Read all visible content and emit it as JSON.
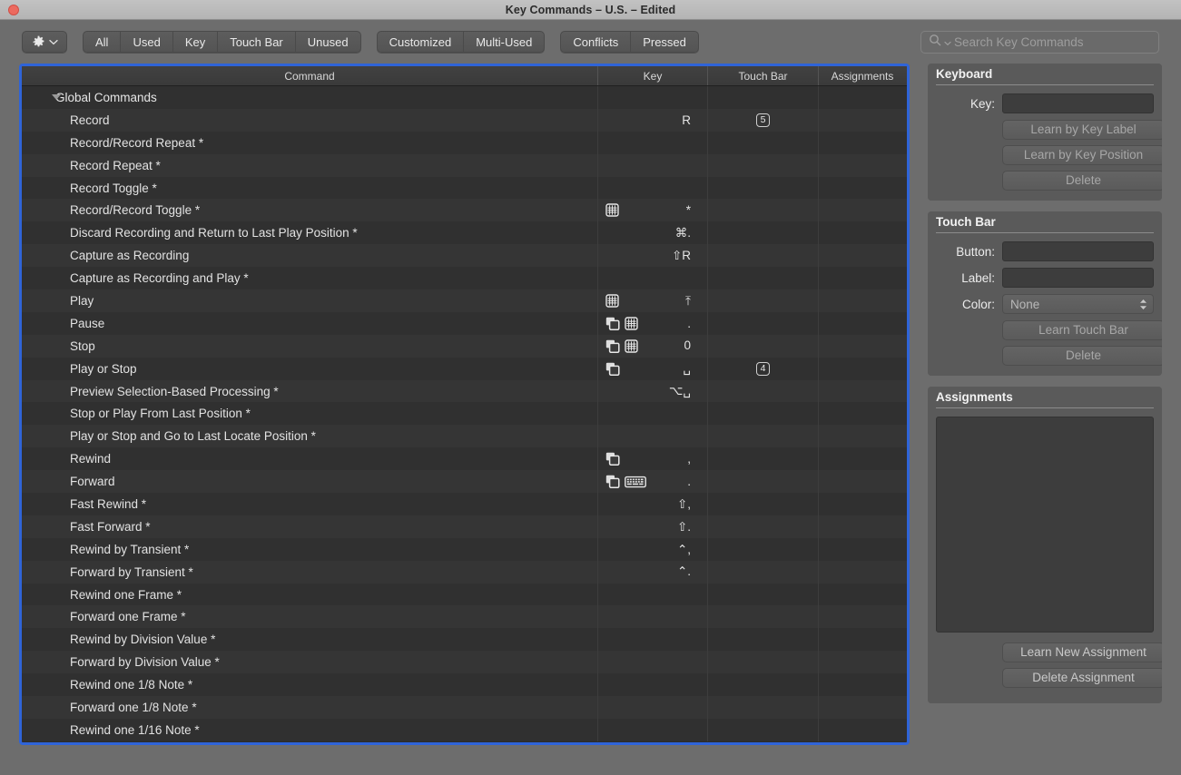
{
  "window": {
    "title": "Key Commands – U.S. – Edited",
    "accent_blue": "#2f64d8",
    "titlebar_bg": "#b9b9b9",
    "chrome_bg": "#6d6d6d",
    "table_bg": "#2c2c2c"
  },
  "toolbar": {
    "gear_icon": "gear-icon",
    "gear_chevron_icon": "chevron-down-icon",
    "filters_primary": [
      "All",
      "Used",
      "Key",
      "Touch Bar",
      "Unused"
    ],
    "filters_secondary": [
      "Customized",
      "Multi-Used"
    ],
    "filters_tertiary": [
      "Conflicts",
      "Pressed"
    ],
    "search": {
      "icon": "search-icon",
      "chevron_icon": "chevron-down-icon",
      "placeholder": "Search Key Commands",
      "value": ""
    }
  },
  "table": {
    "columns": [
      "Command",
      "Key",
      "Touch Bar",
      "Assignments"
    ],
    "rows": [
      {
        "type": "group",
        "command": "Global Commands",
        "key": "",
        "icons": [],
        "touchbar": "",
        "assignments": ""
      },
      {
        "type": "item",
        "command": "Record",
        "key": "R",
        "icons": [],
        "touchbar": "5",
        "assignments": ""
      },
      {
        "type": "item",
        "command": "Record/Record Repeat *",
        "key": "",
        "icons": [],
        "touchbar": "",
        "assignments": ""
      },
      {
        "type": "item",
        "command": "Record Repeat *",
        "key": "",
        "icons": [],
        "touchbar": "",
        "assignments": ""
      },
      {
        "type": "item",
        "command": "Record Toggle *",
        "key": "",
        "icons": [],
        "touchbar": "",
        "assignments": ""
      },
      {
        "type": "item",
        "command": "Record/Record Toggle *",
        "key": "*",
        "icons": [
          "numeric-keypad-icon"
        ],
        "touchbar": "",
        "assignments": ""
      },
      {
        "type": "item",
        "command": "Discard Recording and Return to Last Play Position *",
        "key": "⌘.",
        "icons": [],
        "touchbar": "",
        "assignments": ""
      },
      {
        "type": "item",
        "command": "Capture as Recording",
        "key": "⇧R",
        "icons": [],
        "touchbar": "",
        "assignments": ""
      },
      {
        "type": "item",
        "command": "Capture as Recording and Play *",
        "key": "",
        "icons": [],
        "touchbar": "",
        "assignments": ""
      },
      {
        "type": "item",
        "command": "Play",
        "key": "⤒",
        "icons": [
          "numeric-keypad-icon"
        ],
        "touchbar": "",
        "assignments": ""
      },
      {
        "type": "item",
        "command": "Pause",
        "key": ".",
        "icons": [
          "all-windows-icon",
          "numeric-keypad-icon"
        ],
        "touchbar": "",
        "assignments": ""
      },
      {
        "type": "item",
        "command": "Stop",
        "key": "0",
        "icons": [
          "all-windows-icon",
          "numeric-keypad-icon"
        ],
        "touchbar": "",
        "assignments": ""
      },
      {
        "type": "item",
        "command": "Play or Stop",
        "key": "␣",
        "icons": [
          "all-windows-icon"
        ],
        "touchbar": "4",
        "assignments": ""
      },
      {
        "type": "item",
        "command": "Preview Selection-Based Processing *",
        "key": "⌥␣",
        "icons": [],
        "touchbar": "",
        "assignments": ""
      },
      {
        "type": "item",
        "command": "Stop or Play From Last Position *",
        "key": "",
        "icons": [],
        "touchbar": "",
        "assignments": ""
      },
      {
        "type": "item",
        "command": "Play or Stop and Go to Last Locate Position *",
        "key": "",
        "icons": [],
        "touchbar": "",
        "assignments": ""
      },
      {
        "type": "item",
        "command": "Rewind",
        "key": ",",
        "icons": [
          "all-windows-icon"
        ],
        "touchbar": "",
        "assignments": ""
      },
      {
        "type": "item",
        "command": "Forward",
        "key": ".",
        "icons": [
          "all-windows-icon",
          "keyboard-icon"
        ],
        "touchbar": "",
        "assignments": ""
      },
      {
        "type": "item",
        "command": "Fast Rewind *",
        "key": "⇧,",
        "icons": [],
        "touchbar": "",
        "assignments": ""
      },
      {
        "type": "item",
        "command": "Fast Forward *",
        "key": "⇧.",
        "icons": [],
        "touchbar": "",
        "assignments": ""
      },
      {
        "type": "item",
        "command": "Rewind by Transient *",
        "key": "⌃,",
        "icons": [],
        "touchbar": "",
        "assignments": ""
      },
      {
        "type": "item",
        "command": "Forward by Transient *",
        "key": "⌃.",
        "icons": [],
        "touchbar": "",
        "assignments": ""
      },
      {
        "type": "item",
        "command": "Rewind one Frame *",
        "key": "",
        "icons": [],
        "touchbar": "",
        "assignments": ""
      },
      {
        "type": "item",
        "command": "Forward one Frame *",
        "key": "",
        "icons": [],
        "touchbar": "",
        "assignments": ""
      },
      {
        "type": "item",
        "command": "Rewind by Division Value *",
        "key": "",
        "icons": [],
        "touchbar": "",
        "assignments": ""
      },
      {
        "type": "item",
        "command": "Forward by Division Value *",
        "key": "",
        "icons": [],
        "touchbar": "",
        "assignments": ""
      },
      {
        "type": "item",
        "command": "Rewind one 1/8 Note *",
        "key": "",
        "icons": [],
        "touchbar": "",
        "assignments": ""
      },
      {
        "type": "item",
        "command": "Forward one 1/8 Note *",
        "key": "",
        "icons": [],
        "touchbar": "",
        "assignments": ""
      },
      {
        "type": "item",
        "command": "Rewind one 1/16 Note *",
        "key": "",
        "icons": [],
        "touchbar": "",
        "assignments": ""
      }
    ]
  },
  "sidebar": {
    "keyboard": {
      "title": "Keyboard",
      "key_label": "Key:",
      "key_value": "",
      "learn_by_key_label": "Learn by Key Label",
      "learn_by_key_position": "Learn by Key Position",
      "delete": "Delete"
    },
    "touchbar": {
      "title": "Touch Bar",
      "button_label": "Button:",
      "button_value": "",
      "label_label": "Label:",
      "label_value": "",
      "color_label": "Color:",
      "color_value": "None",
      "color_chevron_icon": "chevron-updown-icon",
      "learn_touch_bar": "Learn Touch Bar",
      "delete": "Delete"
    },
    "assignments": {
      "title": "Assignments",
      "items": [],
      "learn_new_assignment": "Learn New Assignment",
      "delete_assignment": "Delete Assignment"
    }
  }
}
